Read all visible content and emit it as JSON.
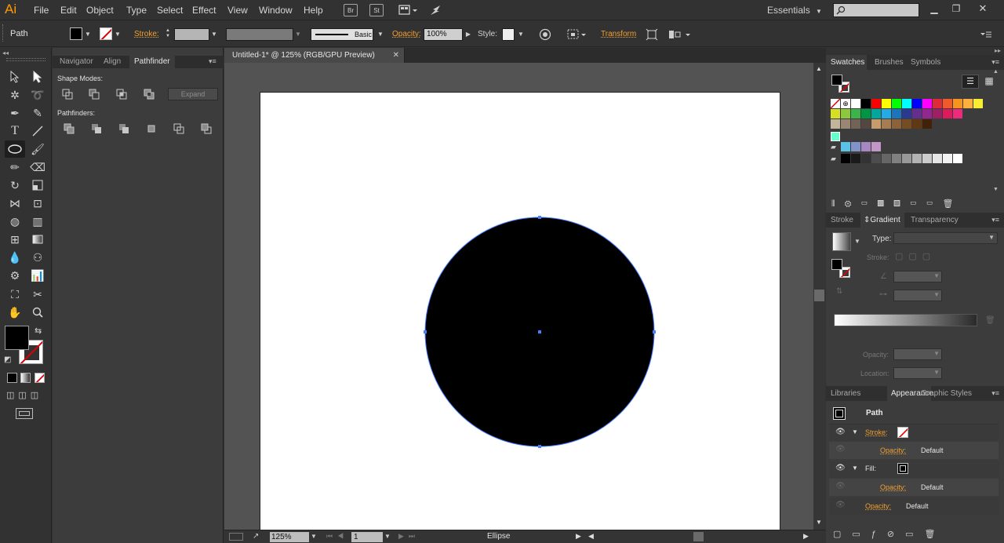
{
  "menubar": {
    "logo": "Ai",
    "items": [
      "File",
      "Edit",
      "Object",
      "Type",
      "Select",
      "Effect",
      "View",
      "Window",
      "Help"
    ],
    "bridge": "Br",
    "stock": "St",
    "workspace": "Essentials"
  },
  "control": {
    "object_type": "Path",
    "stroke_label": "Stroke:",
    "brush_label": "Basic",
    "opacity_label": "Opacity:",
    "opacity_value": "100%",
    "style_label": "Style:",
    "transform_label": "Transform"
  },
  "pathfinder_panel": {
    "tabs": [
      "Navigator",
      "Align",
      "Pathfinder"
    ],
    "shape_modes_label": "Shape Modes:",
    "expand_label": "Expand",
    "pathfinders_label": "Pathfinders:"
  },
  "document": {
    "tab_title": "Untitled-1* @ 125% (RGB/GPU Preview)",
    "zoom": "125%",
    "artboard_number": "1",
    "status_text": "Ellipse"
  },
  "swatches_panel": {
    "tabs": [
      "Swatches",
      "Brushes",
      "Symbols"
    ],
    "rows": [
      [
        "#ffffff",
        "#000000",
        "#ff0000",
        "#ffff00",
        "#00ff00",
        "#00ffff",
        "#0000ff",
        "#ff00ff",
        "#e02a3a",
        "#ef5a2a",
        "#f7941d",
        "#fbb040",
        "#f9ed32"
      ],
      [
        "#d7df23",
        "#8dc63f",
        "#39b54a",
        "#009444",
        "#00a79d",
        "#27aae1",
        "#1c75bc",
        "#2b3990",
        "#662d91",
        "#92278f",
        "#9e1f63",
        "#da1c5c",
        "#ee2a7b"
      ],
      [
        "#c2b59b",
        "#998675",
        "#736357",
        "#534741",
        "#c69c6d",
        "#a67c52",
        "#8c6239",
        "#754c24",
        "#603913",
        "#42210b"
      ],
      [
        "#5bc2e7",
        "#8193c8",
        "#a588c2",
        "#c297c7"
      ],
      [
        "#000000",
        "#1a1a1a",
        "#333333",
        "#4d4d4d",
        "#666666",
        "#808080",
        "#999999",
        "#b3b3b3",
        "#cccccc",
        "#e6e6e6",
        "#f2f2f2",
        "#ffffff"
      ]
    ]
  },
  "gradient_panel": {
    "tabs": [
      "Stroke",
      "Gradient",
      "Transparency"
    ],
    "type_label": "Type:",
    "stroke_label": "Stroke:",
    "opacity_label": "Opacity:",
    "location_label": "Location:"
  },
  "appearance_panel": {
    "tabs": [
      "Libraries",
      "Appearance",
      "Graphic Styles"
    ],
    "title": "Path",
    "stroke_label": "Stroke:",
    "fill_label": "Fill:",
    "opacity_label": "Opacity:",
    "default_value": "Default"
  },
  "colors": {
    "accent": "#f0a034",
    "selection": "#4a7eff"
  }
}
